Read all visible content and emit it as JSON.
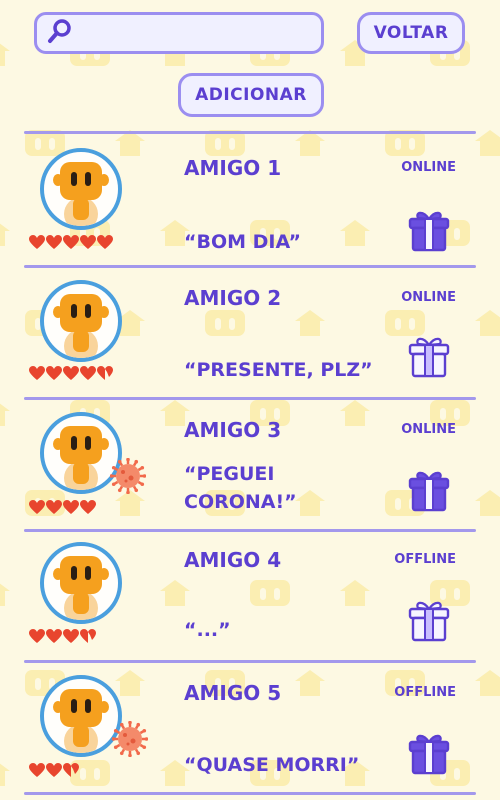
{
  "header": {
    "search_value": "",
    "back_label": "VOLTAR",
    "add_label": "ADICIONAR"
  },
  "colors": {
    "accent": "#5b3fd0",
    "border": "#9b8ef0",
    "background": "#fdf9e3",
    "heart": "#e8452e",
    "ring": "#4a9fde",
    "avatar": "#f5a01e"
  },
  "friends": [
    {
      "name": "AMIGO 1",
      "status": "ONLINE",
      "message": "“BOM DIA”",
      "hearts": 5,
      "infected": false,
      "gift_style": "filled"
    },
    {
      "name": "AMIGO 2",
      "status": "ONLINE",
      "message": "“PRESENTE, PLZ”",
      "hearts": 4.5,
      "infected": false,
      "gift_style": "outline"
    },
    {
      "name": "AMIGO 3",
      "status": "ONLINE",
      "message": "“PEGUEI CORONA!”",
      "hearts": 4,
      "infected": true,
      "gift_style": "filled"
    },
    {
      "name": "AMIGO 4",
      "status": "OFFLINE",
      "message": "“...”",
      "hearts": 3.5,
      "infected": false,
      "gift_style": "outline"
    },
    {
      "name": "AMIGO 5",
      "status": "OFFLINE",
      "message": "“QUASE MORRI”",
      "hearts": 2.5,
      "infected": true,
      "gift_style": "filled"
    }
  ],
  "icons": {
    "search": "search-icon",
    "gift": "gift-icon",
    "heart": "heart-icon",
    "virus": "virus-icon",
    "avatar": "robot-avatar"
  }
}
